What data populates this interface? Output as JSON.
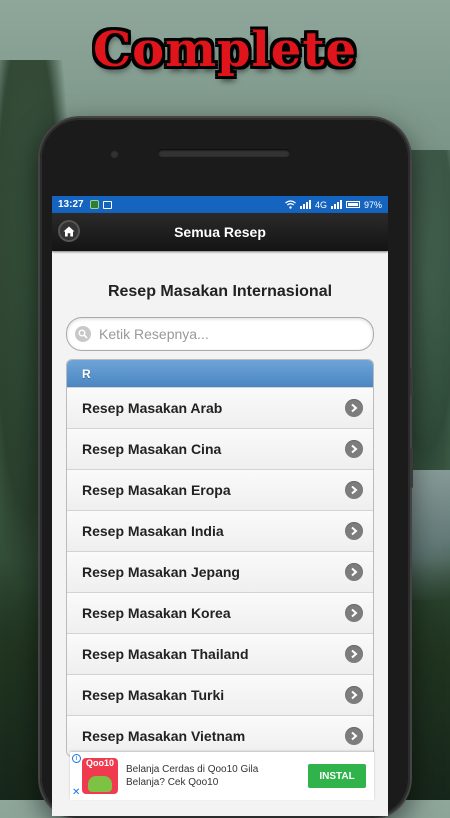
{
  "headline": "Complete",
  "status_bar": {
    "time": "13:27",
    "network": "4G",
    "battery": "97%"
  },
  "app_bar": {
    "title": "Semua Resep",
    "home_icon": "home-icon"
  },
  "page": {
    "title": "Resep Masakan Internasional",
    "search_placeholder": "Ketik Resepnya...",
    "section_header": "R",
    "items": [
      {
        "label": "Resep Masakan Arab"
      },
      {
        "label": "Resep Masakan Cina"
      },
      {
        "label": "Resep Masakan Eropa"
      },
      {
        "label": "Resep Masakan India"
      },
      {
        "label": "Resep Masakan Jepang"
      },
      {
        "label": "Resep Masakan Korea"
      },
      {
        "label": "Resep Masakan Thailand"
      },
      {
        "label": "Resep Masakan Turki"
      },
      {
        "label": "Resep Masakan Vietnam"
      }
    ]
  },
  "ad": {
    "brand": "Qoo10",
    "text": "Belanja Cerdas di Qoo10 Gila Belanja? Cek Qoo10",
    "button": "INSTAL",
    "close": "✕"
  },
  "colors": {
    "accent": "#1565c0",
    "headline": "#e0141b",
    "list_header": "#5b96cf",
    "install_button": "#2fb34a"
  }
}
